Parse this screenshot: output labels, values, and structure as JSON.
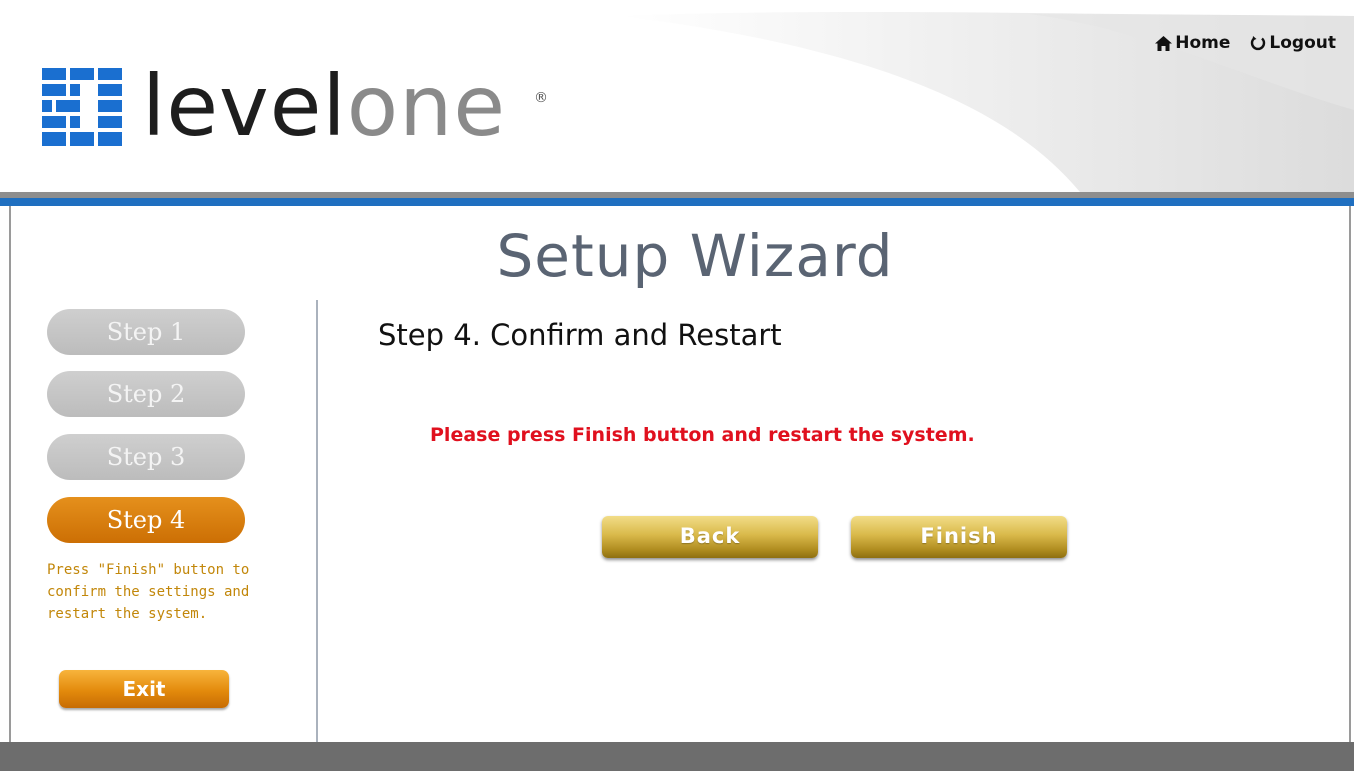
{
  "header": {
    "logo_text_level": "level",
    "logo_text_one": "one",
    "logo_reg": "®",
    "home_label": "Home",
    "logout_label": "Logout"
  },
  "title": "Setup Wizard",
  "sidebar": {
    "steps": [
      {
        "label": "Step 1",
        "state": "inactive"
      },
      {
        "label": "Step 2",
        "state": "inactive"
      },
      {
        "label": "Step 3",
        "state": "inactive"
      },
      {
        "label": "Step 4",
        "state": "active"
      }
    ],
    "description": "Press \"Finish\" button to confirm the settings and restart the system.",
    "exit_label": "Exit"
  },
  "main": {
    "heading": "Step 4. Confirm and Restart",
    "instruction": "Please press Finish button and restart the system.",
    "back_label": "Back",
    "finish_label": "Finish"
  },
  "colors": {
    "accent_blue": "#1f6fc0",
    "active_step": "#d97a0d",
    "warning_text": "#e0101e",
    "description_text": "#c2870a"
  },
  "icons": {
    "logo": "levelone-grid-logo",
    "home": "home-icon",
    "logout": "power-icon"
  }
}
